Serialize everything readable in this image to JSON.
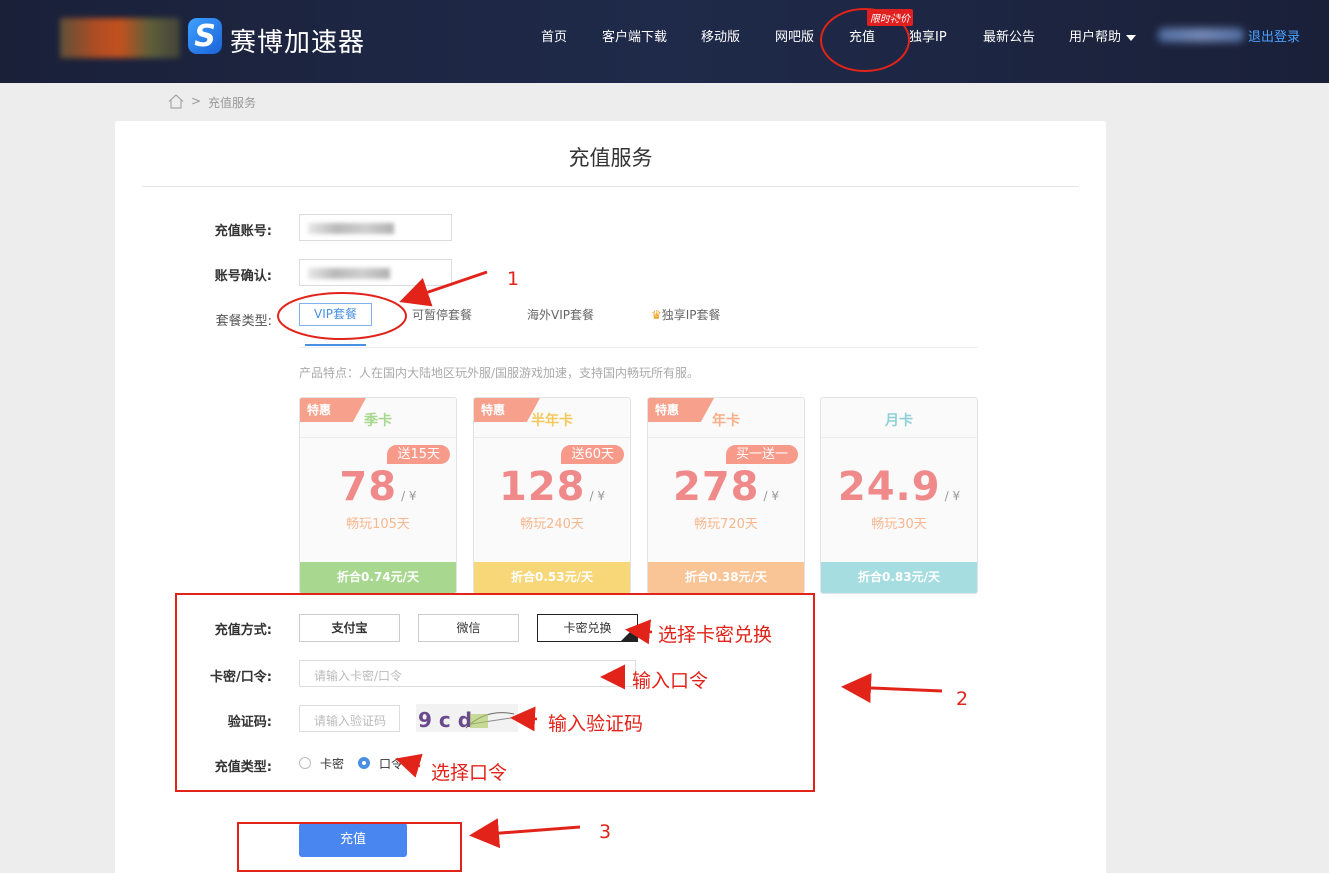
{
  "header": {
    "brand_letter": "S",
    "brand_name": "赛博加速器",
    "nav": [
      "首页",
      "客户端下载",
      "移动版",
      "网吧版",
      "充值",
      "独享IP",
      "最新公告",
      "用户帮助"
    ],
    "promo_badge": "限时特价",
    "logout": "退出登录"
  },
  "breadcrumb": {
    "separator": ">",
    "current": "充值服务"
  },
  "page": {
    "title": "充值服务",
    "account_label": "充值账号:",
    "confirm_label": "账号确认:",
    "package_label": "套餐类型:",
    "package_tabs": [
      "VIP套餐",
      "可暂停套餐",
      "海外VIP套餐",
      "独享IP套餐"
    ],
    "feature_text": "产品特点：人在国内大陆地区玩外服/国服游戏加速，支持国内畅玩所有服。"
  },
  "plans": [
    {
      "corner": "特惠",
      "name": "季卡",
      "bubble": "送15天",
      "price": "78",
      "unit": "/ ¥",
      "days": "畅玩105天",
      "per_day": "折合0.74元/天",
      "color": "#a8d88f",
      "num_color": "#f08a8a"
    },
    {
      "corner": "特惠",
      "name": "半年卡",
      "bubble": "送60天",
      "price": "128",
      "unit": "/ ¥",
      "days": "畅玩240天",
      "per_day": "折合0.53元/天",
      "color": "#f8d779",
      "num_color": "#f08a8a"
    },
    {
      "corner": "特惠",
      "name": "年卡",
      "bubble": "买一送一",
      "price": "278",
      "unit": "/ ¥",
      "days": "畅玩720天",
      "per_day": "折合0.38元/天",
      "color": "#f9c496",
      "num_color": "#f08a8a"
    },
    {
      "corner": "",
      "name": "月卡",
      "bubble": "",
      "price": "24.9",
      "unit": "/ ¥",
      "days": "畅玩30天",
      "per_day": "折合0.83元/天",
      "color": "#a5dde0",
      "num_color": "#f08a8a"
    }
  ],
  "payment": {
    "method_label": "充值方式:",
    "methods": [
      "支付宝",
      "微信",
      "卡密兑换"
    ],
    "code_label": "卡密/口令:",
    "code_placeholder": "请输入卡密/口令",
    "captcha_label": "验证码:",
    "captcha_placeholder": "请输入验证码",
    "captcha_text": "9 c d",
    "type_label": "充值类型:",
    "types": [
      "卡密",
      "口令"
    ],
    "selected_type": "口令"
  },
  "submit": "充值",
  "annotations": {
    "n1": "1",
    "n2": "2",
    "n3": "3",
    "select_card": "选择卡密兑换",
    "enter_code": "输入口令",
    "enter_captcha": "输入验证码",
    "select_code": "选择口令"
  },
  "colors": {
    "header_bg": "#1c2440",
    "accent": "#4a86f0",
    "annotation": "#e2231a"
  }
}
